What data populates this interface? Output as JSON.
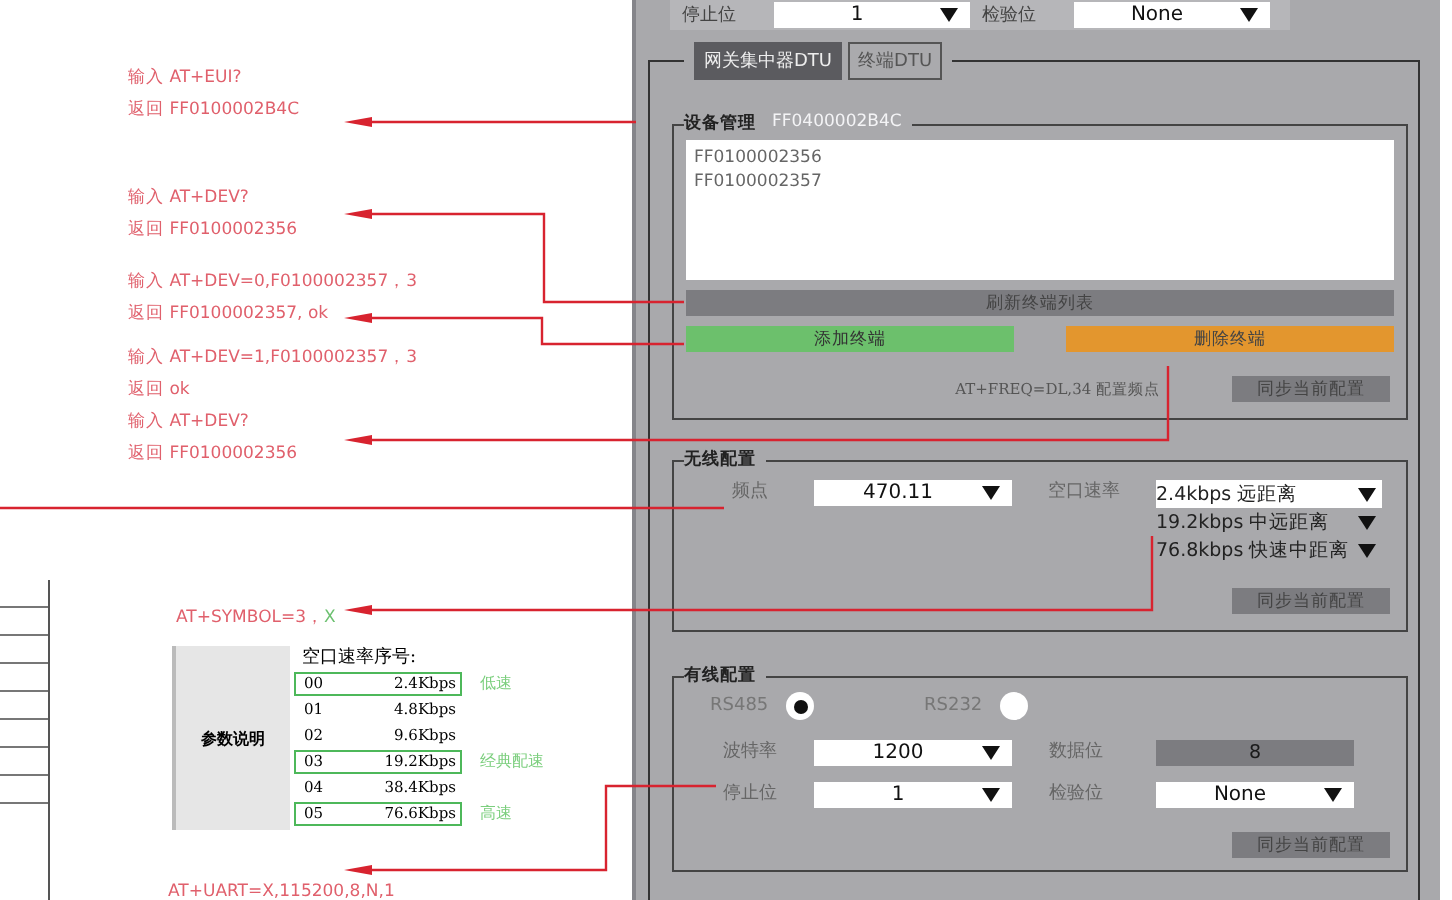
{
  "annotation_groups": [
    {
      "lines": [
        "输入 AT+EUI?",
        "返回 FF0100002B4C"
      ]
    },
    {
      "lines": [
        "输入 AT+DEV?",
        "返回 FF0100002356"
      ]
    },
    {
      "lines": [
        "输入 AT+DEV=0,F0100002357，3",
        "返回 FF0100002357, ok"
      ]
    },
    {
      "lines": [
        "输入 AT+DEV=1,F0100002357，3",
        "返回 ok",
        "输入 AT+DEV?",
        "返回 FF0100002356"
      ]
    }
  ],
  "symbol_command": {
    "command": "AT+SYMBOL=3，",
    "value": "X"
  },
  "param_table": {
    "row_header": "参数说明",
    "title": "空口速率序号:",
    "rows": [
      {
        "code": "00",
        "rate": "2.4Kbps",
        "highlighted": true,
        "note": "低速"
      },
      {
        "code": "01",
        "rate": "4.8Kbps",
        "highlighted": false
      },
      {
        "code": "02",
        "rate": "9.6Kbps",
        "highlighted": false
      },
      {
        "code": "03",
        "rate": "19.2Kbps",
        "highlighted": true,
        "note": "经典配速"
      },
      {
        "code": "04",
        "rate": "38.4Kbps",
        "highlighted": false
      },
      {
        "code": "05",
        "rate": "76.6Kbps",
        "highlighted": true,
        "note": "高速"
      }
    ]
  },
  "uart_command": "AT+UART=X,115200,8,N,1",
  "panel": {
    "top_row": [
      {
        "label": "停止位",
        "value": "1"
      },
      {
        "label": "检验位",
        "value": "None"
      }
    ],
    "tabs": [
      {
        "label": "网关集中器DTU",
        "selected": true
      },
      {
        "label": "终端DTU",
        "selected": false
      }
    ],
    "device_management": {
      "title": "设备管理",
      "eui": "FF0400002B4C",
      "devices": [
        "FF0100002356",
        "FF0100002357"
      ],
      "refresh_button": "刷新终端列表",
      "add_button": "添加终端",
      "delete_button": "删除终端",
      "note": "AT+FREQ=DL,34 配置频点",
      "sync_button": "同步当前配置"
    },
    "wireless": {
      "title": "无线配置",
      "freq_label": "频点",
      "freq_value": "470.11",
      "rate_label": "空口速率",
      "rate_options": [
        {
          "rate": "2.4kbps",
          "desc": "远距离",
          "selected": true
        },
        {
          "rate": "19.2kbps",
          "desc": "中远距离",
          "selected": false
        },
        {
          "rate": "76.8kbps",
          "desc": "快速中距离",
          "selected": false
        }
      ],
      "sync_button": "同步当前配置"
    },
    "wired": {
      "title": "有线配置",
      "interfaces": [
        {
          "label": "RS485",
          "selected": true
        },
        {
          "label": "RS232",
          "selected": false
        }
      ],
      "fields": [
        {
          "label": "波特率",
          "value": "1200",
          "kind": "dropdown"
        },
        {
          "label": "数据位",
          "value": "8",
          "kind": "readonly"
        },
        {
          "label": "停止位",
          "value": "1",
          "kind": "dropdown"
        },
        {
          "label": "检验位",
          "value": "None",
          "kind": "dropdown"
        }
      ],
      "sync_button": "同步当前配置"
    }
  }
}
